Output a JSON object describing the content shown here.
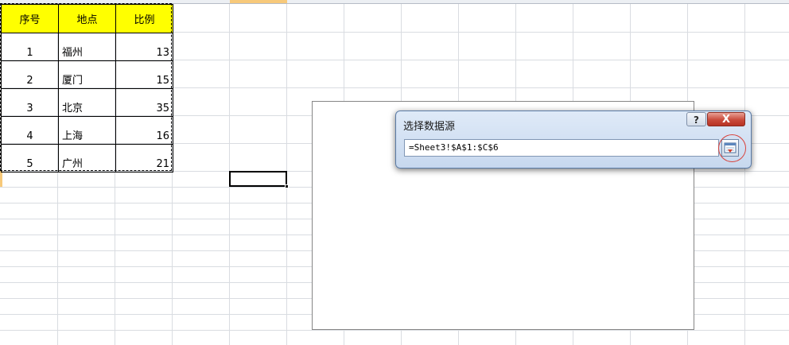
{
  "table": {
    "headers": [
      "序号",
      "地点",
      "比例"
    ],
    "rows": [
      {
        "index": "1",
        "place": "福州",
        "ratio": "13"
      },
      {
        "index": "2",
        "place": "厦门",
        "ratio": "15"
      },
      {
        "index": "3",
        "place": "北京",
        "ratio": "35"
      },
      {
        "index": "4",
        "place": "上海",
        "ratio": "16"
      },
      {
        "index": "5",
        "place": "广州",
        "ratio": "21"
      }
    ]
  },
  "dialog": {
    "title": "选择数据源",
    "help_label": "?",
    "close_label": "X",
    "range_value": "=Sheet3!$A$1:$C$6"
  },
  "colors": {
    "header_fill": "#ffff00",
    "active_header": "#f7c97a",
    "annotation_circle": "#d9433c"
  }
}
